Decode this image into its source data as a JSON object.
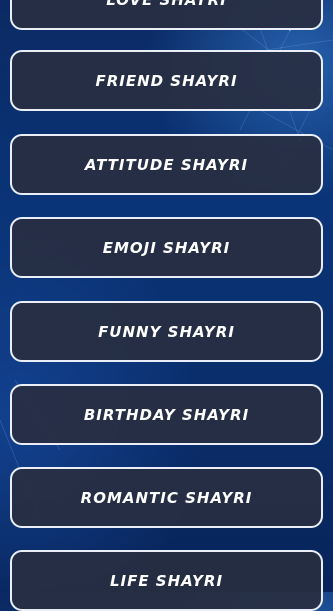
{
  "menu": {
    "items": [
      {
        "label": "LOVE SHAYRI"
      },
      {
        "label": "FRIEND SHAYRI"
      },
      {
        "label": "ATTITUDE SHAYRI"
      },
      {
        "label": "EMOJI SHAYRI"
      },
      {
        "label": "FUNNY SHAYRI"
      },
      {
        "label": "BIRTHDAY SHAYRI"
      },
      {
        "label": "ROMANTIC SHAYRI"
      },
      {
        "label": "LIFE SHAYRI"
      }
    ]
  },
  "colors": {
    "background": "#0a3478",
    "button_fill": "#282e42",
    "button_border": "#e9eef7",
    "text": "#ffffff"
  }
}
